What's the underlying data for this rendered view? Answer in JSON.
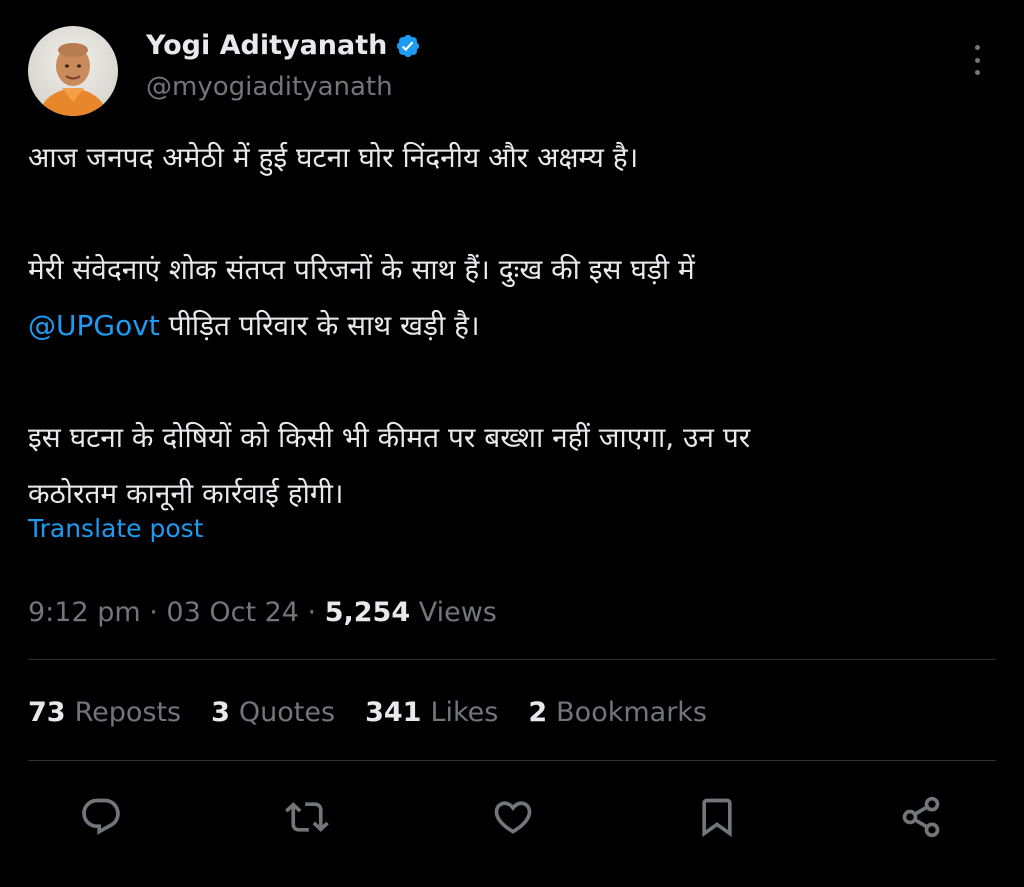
{
  "author": {
    "display_name": "Yogi Adityanath",
    "handle": "@myogiadityanath",
    "verified_icon": "verified-badge-icon",
    "verified_color": "#1d9bf0"
  },
  "more_icon": "more-options-icon",
  "tweet": {
    "para1": "आज जनपद अमेठी में हुई घटना घोर निंदनीय और अक्षम्य है।",
    "para2_line1": "मेरी संवेदनाएं शोक संतप्त परिजनों के साथ हैं। दुःख की इस घड़ी में",
    "para2_mention": "@UPGovt",
    "para2_rest": " पीड़ित परिवार के साथ खड़ी है।",
    "para3_line1": "इस घटना के दोषियों को किसी भी कीमत पर बख्शा नहीं जाएगा, उन पर",
    "para3_line2": "कठोरतम कानूनी कार्रवाई होगी।"
  },
  "translate_label": "Translate post",
  "meta": {
    "time": "9:12 pm",
    "separator": " · ",
    "date": "03 Oct 24",
    "views_count": "5,254",
    "views_label": " Views"
  },
  "stats": {
    "reposts_count": "73",
    "reposts_label": "Reposts",
    "quotes_count": "3",
    "quotes_label": "Quotes",
    "likes_count": "341",
    "likes_label": "Likes",
    "bookmarks_count": "2",
    "bookmarks_label": "Bookmarks"
  },
  "actions": [
    "reply-icon",
    "repost-icon",
    "like-icon",
    "bookmark-icon",
    "share-icon"
  ],
  "colors": {
    "background": "#000000",
    "text": "#e7e9ea",
    "secondary": "#71767b",
    "link": "#1d9bf0",
    "divider": "#2f3336"
  }
}
